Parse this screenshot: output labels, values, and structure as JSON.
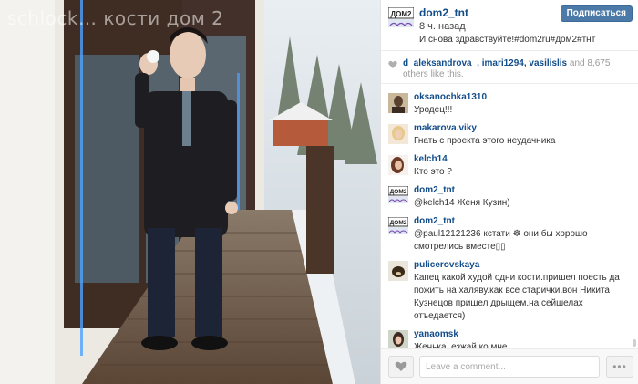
{
  "photo": {
    "watermark": "schlock… кости дом 2"
  },
  "post": {
    "username": "dom2_tnt",
    "time_ago": "8 ч. назад",
    "caption": "И снова здравствуйте!#dom2ru#дом2#тнт",
    "follow_label": "Подписаться"
  },
  "likes": {
    "names": "d_aleksandrova_, imari1294, vasilislis",
    "others": " and 8,675 others like this."
  },
  "comments": [
    {
      "user": "oksanochka1310",
      "text": "Уродец!!!",
      "avatar": "dark"
    },
    {
      "user": "makarova.viky",
      "text": "Гнать с проекта этого неудачника",
      "avatar": "blonde"
    },
    {
      "user": "kelch14",
      "text": "Кто это ?",
      "avatar": "brunette"
    },
    {
      "user": "dom2_tnt",
      "text": "@kelch14 Женя Кузин)",
      "avatar": "logo"
    },
    {
      "user": "dom2_tnt",
      "text": "@paul12121236 кстати ☸ они бы хорошо смотрелись вместе▯▯",
      "avatar": "logo"
    },
    {
      "user": "pulicerovskaya",
      "text": "Капец какой худой одни кости.пришел поесть да пожить на халяву.как все старички.вон Никита Кузнецов пришел дрыщем.на сейшелах отъедается)",
      "avatar": "dog"
    },
    {
      "user": "yanaomsk",
      "text": "Женька, езжай ко мне",
      "avatar": "girl"
    }
  ],
  "footer": {
    "comment_placeholder": "Leave a comment...",
    "more_label": "•••"
  },
  "colors": {
    "link": "#124d8a",
    "follow_button": "#4b7aa8"
  }
}
